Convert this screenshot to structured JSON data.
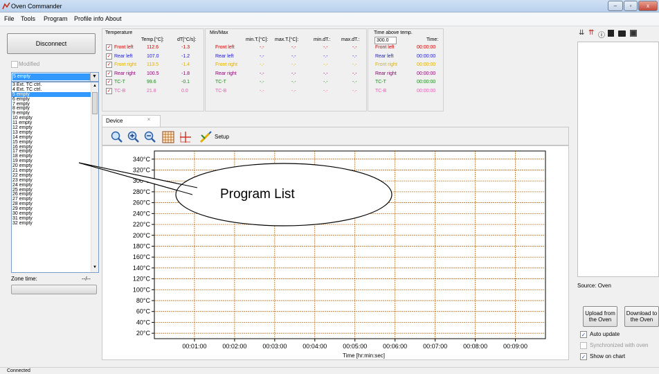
{
  "window": {
    "title": "Oven Commander",
    "min": "–",
    "max": "▫",
    "close": "x"
  },
  "menu": [
    "File",
    "Tools",
    "Program",
    "Profile info",
    "About"
  ],
  "left": {
    "disconnect": "Disconnect",
    "modified": "Modified",
    "selected_program": "5 empty",
    "programs": [
      "3 Ext. TC ctrl.",
      "4 Ext. TC ctrl.",
      "5 empty",
      "6 empty",
      "7 empty",
      "8 empty",
      "9 empty",
      "10 empty",
      "11 empty",
      "12 empty",
      "13 empty",
      "14 empty",
      "15 empty",
      "16 empty",
      "17 empty",
      "18 empty",
      "19 empty",
      "20 empty",
      "21 empty",
      "22 empty",
      "23 empty",
      "24 empty",
      "25 empty",
      "26 empty",
      "27 empty",
      "28 empty",
      "29 empty",
      "30 empty",
      "31 empty",
      "32 empty"
    ],
    "zone_time_label": "Zone time:",
    "zone_time_value": "--/--"
  },
  "temperature": {
    "title": "Temperature",
    "h_temp": "Temp.[°C]:",
    "h_dt": "dT[°C/s]:",
    "rows": [
      {
        "name": "Front left",
        "temp": "112.6",
        "dt": "-1.3",
        "color": "#cc0000"
      },
      {
        "name": "Rear left",
        "temp": "107.0",
        "dt": "-1.2",
        "color": "#1a1acc"
      },
      {
        "name": "Front right",
        "temp": "113.5",
        "dt": "-1.4",
        "color": "#e0b000"
      },
      {
        "name": "Rear right",
        "temp": "100.5",
        "dt": "-1.8",
        "color": "#8b0070"
      },
      {
        "name": "TC-T",
        "temp": "99.6",
        "dt": "-0.1",
        "color": "#1a8a1a"
      },
      {
        "name": "TC-B",
        "temp": "21.8",
        "dt": "0.0",
        "color": "#e060b0"
      }
    ]
  },
  "minmax": {
    "title": "Min/Max",
    "h_mint": "min.T.[°C]:",
    "h_maxt": "max.T.[°C]:",
    "h_mindt": "min.dT.:",
    "h_maxdt": "max.dT.:",
    "rows": [
      {
        "name": "Front left",
        "v": "-.-"
      },
      {
        "name": "Rear left",
        "v": "-.-"
      },
      {
        "name": "Front right",
        "v": "-.-"
      },
      {
        "name": "Rear right",
        "v": "-.-"
      },
      {
        "name": "TC-T",
        "v": "-.-"
      },
      {
        "name": "TC-B",
        "v": "-.-"
      }
    ]
  },
  "timeabove": {
    "title": "Time above temp.",
    "value": "300.0",
    "h_time": "Time:",
    "rows": [
      {
        "name": "Front left",
        "time": "00:00:00"
      },
      {
        "name": "Rear left",
        "time": "00:00:00"
      },
      {
        "name": "Front right",
        "time": "00:00:00"
      },
      {
        "name": "Rear right",
        "time": "00:00:00"
      },
      {
        "name": "TC-T",
        "time": "00:00:00"
      },
      {
        "name": "TC-B",
        "time": "00:00:00"
      }
    ]
  },
  "device_tab": {
    "label": "Device",
    "close": "×"
  },
  "toolbar": {
    "setup": "Setup"
  },
  "callout": {
    "text": "Program List"
  },
  "right": {
    "source": "Source: Oven",
    "upload": "Upload from the Oven",
    "download": "Download to the Oven",
    "auto_update": "Auto update",
    "synchronized": "Synchronized with oven",
    "show_on_chart": "Show on chart"
  },
  "status": {
    "text": "Connected"
  },
  "chart_data": {
    "type": "line",
    "series": [],
    "xlabel": "Time [hr:min:sec]",
    "ylabel": "",
    "yticks": [
      "20°C",
      "40°C",
      "60°C",
      "80°C",
      "100°C",
      "120°C",
      "140°C",
      "160°C",
      "180°C",
      "200°C",
      "220°C",
      "240°C",
      "260°C",
      "280°C",
      "300°C",
      "320°C",
      "340°C"
    ],
    "xticks": [
      "00:01:00",
      "00:02:00",
      "00:03:00",
      "00:04:00",
      "00:05:00",
      "00:06:00",
      "00:07:00",
      "00:08:00",
      "00:09:00"
    ],
    "ylim": [
      10,
      355
    ],
    "grid": true,
    "grid_color": "#b35a00"
  }
}
